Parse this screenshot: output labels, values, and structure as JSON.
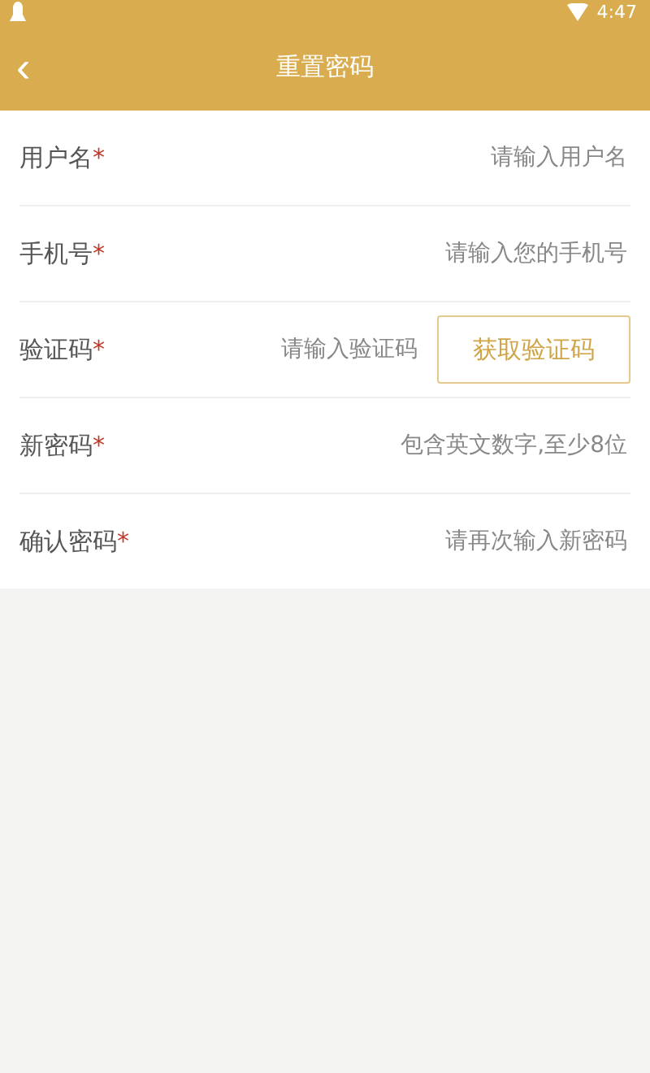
{
  "status_bar": {
    "time": "4:47"
  },
  "header": {
    "back": "‹",
    "title": "重置密码"
  },
  "fields": [
    {
      "kind": "text",
      "label": "用户名",
      "mark": "*",
      "placeholder": "请输入用户名"
    },
    {
      "kind": "text",
      "label": "手机号",
      "mark": "*",
      "placeholder": "请输入您的手机号"
    },
    {
      "kind": "code",
      "label": "验证码",
      "mark": "*",
      "placeholder": "请输入验证码",
      "button": "获取验证码"
    },
    {
      "kind": "text",
      "label": "新密码",
      "mark": "*",
      "placeholder": "包含英文数字,至少8位"
    },
    {
      "kind": "text",
      "label": "确认密码",
      "mark": "*",
      "placeholder": "请再次输入新密码"
    }
  ]
}
